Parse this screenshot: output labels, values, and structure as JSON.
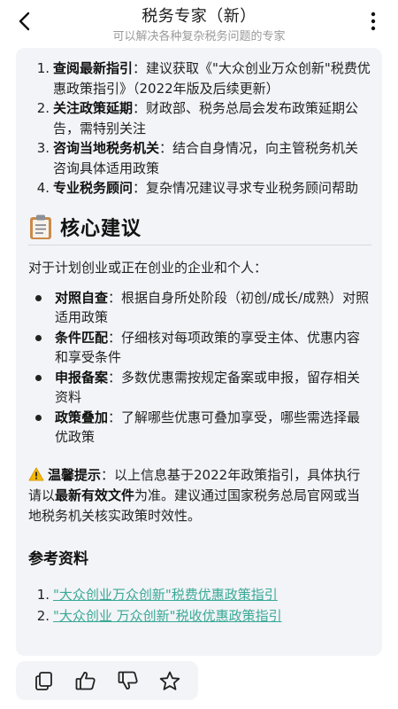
{
  "header": {
    "title": "税务专家（新）",
    "subtitle": "可以解决各种复杂税务问题的专家",
    "back_icon": "chevron-left-icon",
    "more_icon": "more-vertical-icon"
  },
  "steps": [
    {
      "num": "1.",
      "key": "查阅最新指引",
      "text": "：建议获取《\"大众创业万众创新\"税费优惠政策指引》（2022年版及后续更新）"
    },
    {
      "num": "2.",
      "key": "关注政策延期",
      "text": "：财政部、税务总局会发布政策延期公告，需特别关注"
    },
    {
      "num": "3.",
      "key": "咨询当地税务机关",
      "text": "：结合自身情况，向主管税务机关咨询具体适用政策"
    },
    {
      "num": "4.",
      "key": "专业税务顾问",
      "text": "：复杂情况建议寻求专业税务顾问帮助"
    }
  ],
  "core": {
    "icon": "clipboard-icon",
    "title": "核心建议",
    "intro": "对于计划创业或正在创业的企业和个人：",
    "tips": [
      {
        "key": "对照自查",
        "text": "：根据自身所处阶段（初创/成长/成熟）对照适用政策"
      },
      {
        "key": "条件匹配",
        "text": "：仔细核对每项政策的享受主体、优惠内容和享受条件"
      },
      {
        "key": "申报备案",
        "text": "：多数优惠需按规定备案或申报，留存相关资料"
      },
      {
        "key": "政策叠加",
        "text": "：了解哪些优惠可叠加享受，哪些需选择最优政策"
      }
    ]
  },
  "warning": {
    "icon": "warning-icon",
    "key": "温馨提示",
    "text1": "：以上信息基于2022年政策指引，具体执行请以",
    "key2": "最新有效文件",
    "text2": "为准。建议通过国家税务总局官网或当地税务机关核实政策时效性。"
  },
  "refs": {
    "title": "参考资料",
    "items": [
      {
        "num": "1.",
        "text": "\"大众创业万众创新\"税费优惠政策指引"
      },
      {
        "num": "2.",
        "text": "\"大众创业 万众创新\"税收优惠政策指引"
      }
    ]
  },
  "actions": [
    {
      "name": "copy-button",
      "icon": "copy-icon"
    },
    {
      "name": "like-button",
      "icon": "thumbs-up-icon"
    },
    {
      "name": "dislike-button",
      "icon": "thumbs-down-icon"
    },
    {
      "name": "favorite-button",
      "icon": "star-icon"
    }
  ]
}
